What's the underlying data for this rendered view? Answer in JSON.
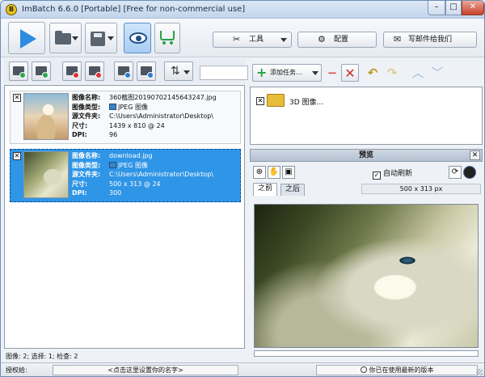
{
  "window": {
    "title": "ImBatch 6.6.0 [Portable] [Free for non-commercial use]",
    "app_icon_letter": "B",
    "minimize": "–",
    "maximize": "□",
    "close": "✕"
  },
  "toolbar": {
    "tools_label": "工具",
    "config_label": "配置",
    "mail_label": "写邮件给我们",
    "tools_icon": "✂",
    "config_icon": "⚙",
    "mail_icon": "✉"
  },
  "image_list": {
    "items": [
      {
        "checked": "✕",
        "name_label": "图像名称:",
        "name": "360截图20190702145643247.jpg",
        "type_label": "图像类型:",
        "type": "JPEG 图像",
        "source_label": "源文件夹:",
        "source": "C:\\Users\\Administrator\\Desktop\\",
        "size_label": "尺寸:",
        "size": "1439 x 810 @ 24",
        "dpi_label": "DPI:",
        "dpi": "96"
      },
      {
        "checked": "✕",
        "name_label": "图像名称:",
        "name": "download.jpg",
        "type_label": "图像类型:",
        "type": "JPEG 图像",
        "source_label": "源文件夹:",
        "source": "C:\\Users\\Administrator\\Desktop\\",
        "size_label": "尺寸:",
        "size": "500 x 313 @ 24",
        "dpi_label": "DPI:",
        "dpi": "300"
      }
    ],
    "status": "图像: 2; 选择: 1; 检查: 2"
  },
  "tasks": {
    "add_task_label": "添加任务...",
    "items": [
      {
        "checked": "✕",
        "label": "3D 图像..."
      }
    ]
  },
  "preview": {
    "title": "预览",
    "close": "✕",
    "auto_refresh_label": "自动刷新",
    "auto_refresh_checked": "✓",
    "tab_before": "之前",
    "tab_after": "之后",
    "dimensions": "500 x 313 px"
  },
  "bottom": {
    "auth_label": "授权给:",
    "name_placeholder": "<点击这里设置你的名字>",
    "version_status": "你已在使用最新的版本"
  }
}
